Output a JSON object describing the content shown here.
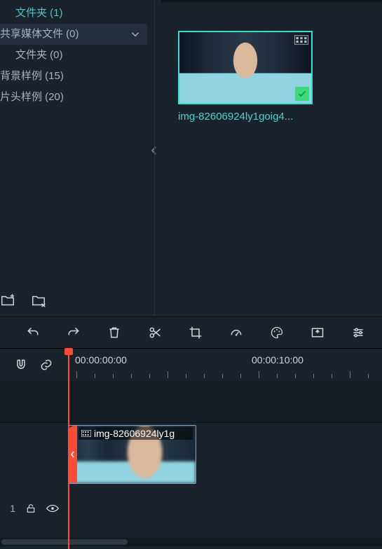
{
  "sidebar": {
    "items": [
      {
        "label": "文件夹 (1)"
      },
      {
        "label": "共享媒体文件 (0)"
      },
      {
        "label": "文件夹 (0)"
      },
      {
        "label": "背景样例 (15)"
      },
      {
        "label": "片头样例 (20)"
      }
    ]
  },
  "media": {
    "thumb_label": "img-82606924ly1goig4..."
  },
  "toolbar": {
    "undo": "undo",
    "redo": "redo",
    "delete": "delete",
    "cut": "cut",
    "crop": "crop",
    "speed": "speed",
    "color": "color",
    "stabilize": "stabilize",
    "adjust": "adjust"
  },
  "timeline": {
    "labels": [
      "00:00:00:00",
      "00:00:10:00"
    ],
    "track_number": "1",
    "clip_label": "img-82606924ly1g"
  },
  "icons": {
    "chevron_down": "▾",
    "collapse_left": "◂",
    "checkmark": "✓"
  }
}
